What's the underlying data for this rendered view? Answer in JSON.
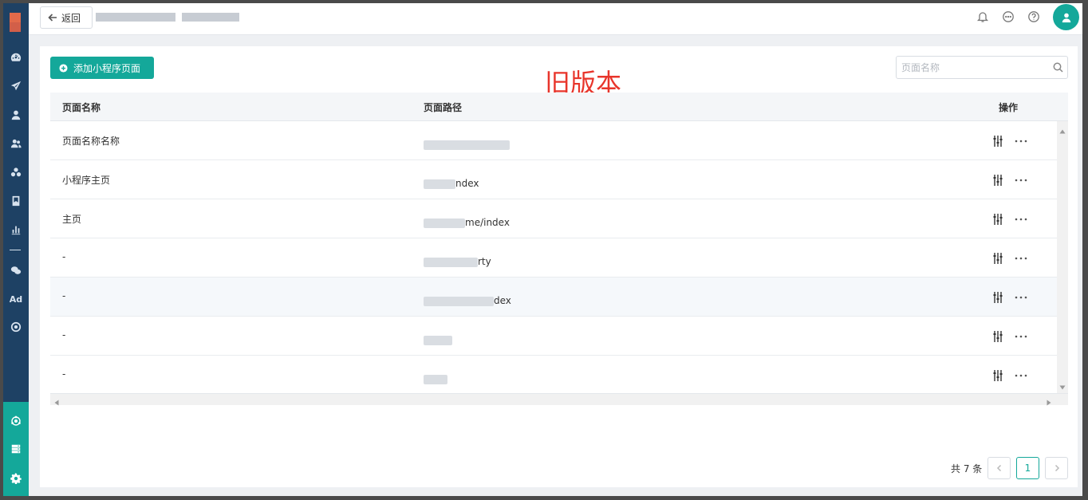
{
  "header": {
    "back_label": "返回",
    "icons": [
      "bell-icon",
      "message-icon",
      "help-icon",
      "user-avatar-icon"
    ]
  },
  "sidebar": {
    "icons": [
      "dashboard-icon",
      "send-icon",
      "user-icon",
      "users-icon",
      "apps-icon",
      "bookmark-icon",
      "bar-chart-icon",
      "wechat-icon",
      "ad-icon",
      "target-icon"
    ],
    "ad_label": "Ad",
    "bottom_icons": [
      "hub-icon",
      "server-icon",
      "gear-icon"
    ]
  },
  "toolbar": {
    "add_label": "添加小程序页面",
    "watermark": "旧版本",
    "search_placeholder": "页面名称"
  },
  "table": {
    "columns": [
      "页面名称",
      "页面路径",
      "操作"
    ],
    "rows": [
      {
        "name": "页面名称名称",
        "path_visible": ""
      },
      {
        "name": "小程序主页",
        "path_visible": "ndex"
      },
      {
        "name": "主页",
        "path_visible": "me/index"
      },
      {
        "name": "-",
        "path_visible": "rty"
      },
      {
        "name": "-",
        "path_visible": "dex"
      },
      {
        "name": "-",
        "path_visible": ""
      },
      {
        "name": "-",
        "path_visible": ""
      }
    ]
  },
  "pagination": {
    "total_label": "共 7 条",
    "current_page": "1"
  },
  "colors": {
    "accent": "#14a89a",
    "sidebar": "#1e4164",
    "watermark": "#e8352b"
  }
}
